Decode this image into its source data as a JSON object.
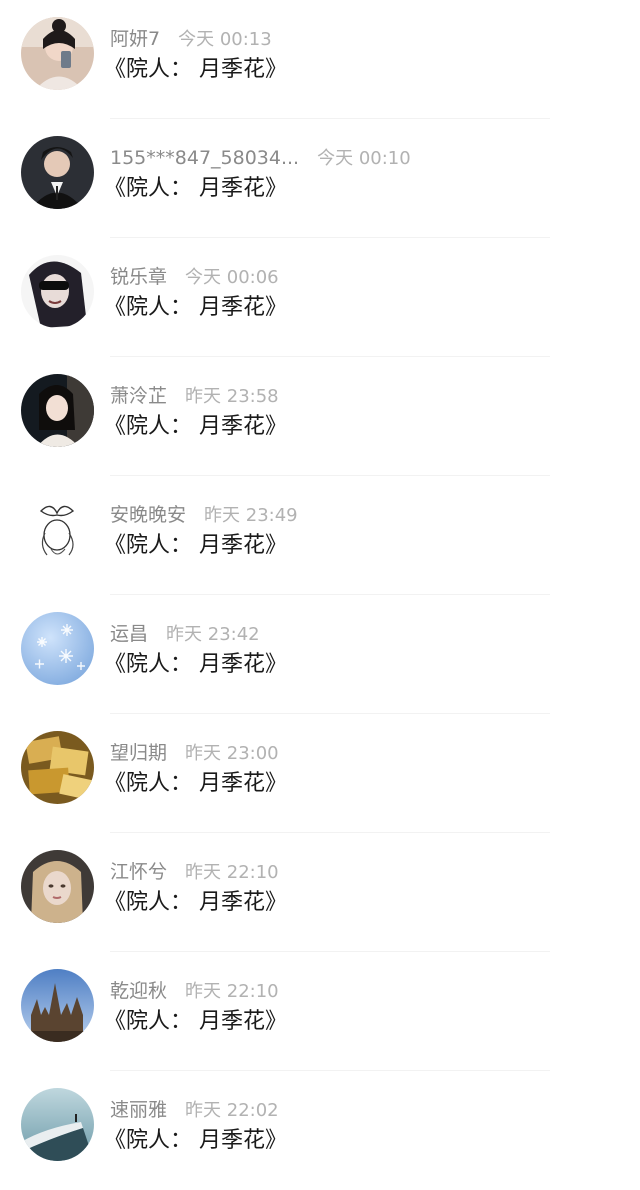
{
  "messages": [
    {
      "name": "阿妍7",
      "time": "今天 00:13",
      "text": "《院人： 月季花》",
      "avatar": "woman-selfie-avatar"
    },
    {
      "name": "155***847_58034...",
      "time": "今天 00:10",
      "text": "《院人： 月季花》",
      "avatar": "man-suit-avatar"
    },
    {
      "name": "锐乐章",
      "time": "今天 00:06",
      "text": "《院人： 月季花》",
      "avatar": "masked-figure-avatar"
    },
    {
      "name": "萧泠芷",
      "time": "昨天 23:58",
      "text": "《院人： 月季花》",
      "avatar": "anime-girl-avatar"
    },
    {
      "name": "安晚晚安",
      "time": "昨天 23:49",
      "text": "《院人： 月季花》",
      "avatar": "sketch-bow-avatar"
    },
    {
      "name": "运昌",
      "time": "昨天 23:42",
      "text": "《院人： 月季花》",
      "avatar": "snowflake-avatar"
    },
    {
      "name": "望归期",
      "time": "昨天 23:00",
      "text": "《院人： 月季花》",
      "avatar": "gold-tickets-avatar"
    },
    {
      "name": "江怀兮",
      "time": "昨天 22:10",
      "text": "《院人： 月季花》",
      "avatar": "blonde-girl-avatar"
    },
    {
      "name": "乾迎秋",
      "time": "昨天 22:10",
      "text": "《院人： 月季花》",
      "avatar": "cathedral-avatar"
    },
    {
      "name": "速丽雅",
      "time": "昨天 22:02",
      "text": "《院人： 月季花》",
      "avatar": "cliff-scene-avatar"
    }
  ]
}
